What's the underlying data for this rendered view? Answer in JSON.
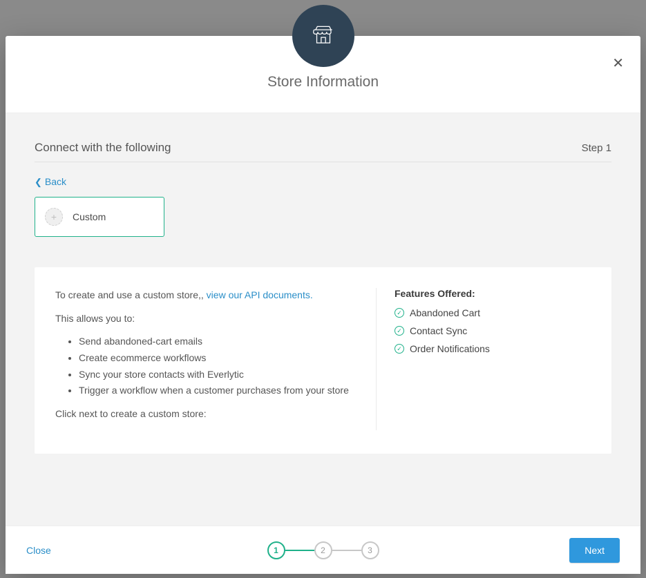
{
  "header": {
    "title": "Store Information"
  },
  "section": {
    "title": "Connect with the following",
    "step_label": "Step 1"
  },
  "back_label": "Back",
  "store_option": {
    "label": "Custom"
  },
  "info": {
    "intro_prefix": "To create and use a custom store,, ",
    "intro_link": "view our API documents.",
    "allows_label": "This allows you to:",
    "bullets": [
      "Send abandoned-cart emails",
      "Create ecommerce workflows",
      "Sync your store contacts with Everlytic",
      "Trigger a workflow when a customer purchases from your store"
    ],
    "next_hint": "Click next to create a custom store:"
  },
  "features": {
    "heading": "Features Offered:",
    "items": [
      "Abandoned Cart",
      "Contact Sync",
      "Order Notifications"
    ]
  },
  "footer": {
    "close_label": "Close",
    "next_label": "Next",
    "steps": [
      "1",
      "2",
      "3"
    ]
  }
}
